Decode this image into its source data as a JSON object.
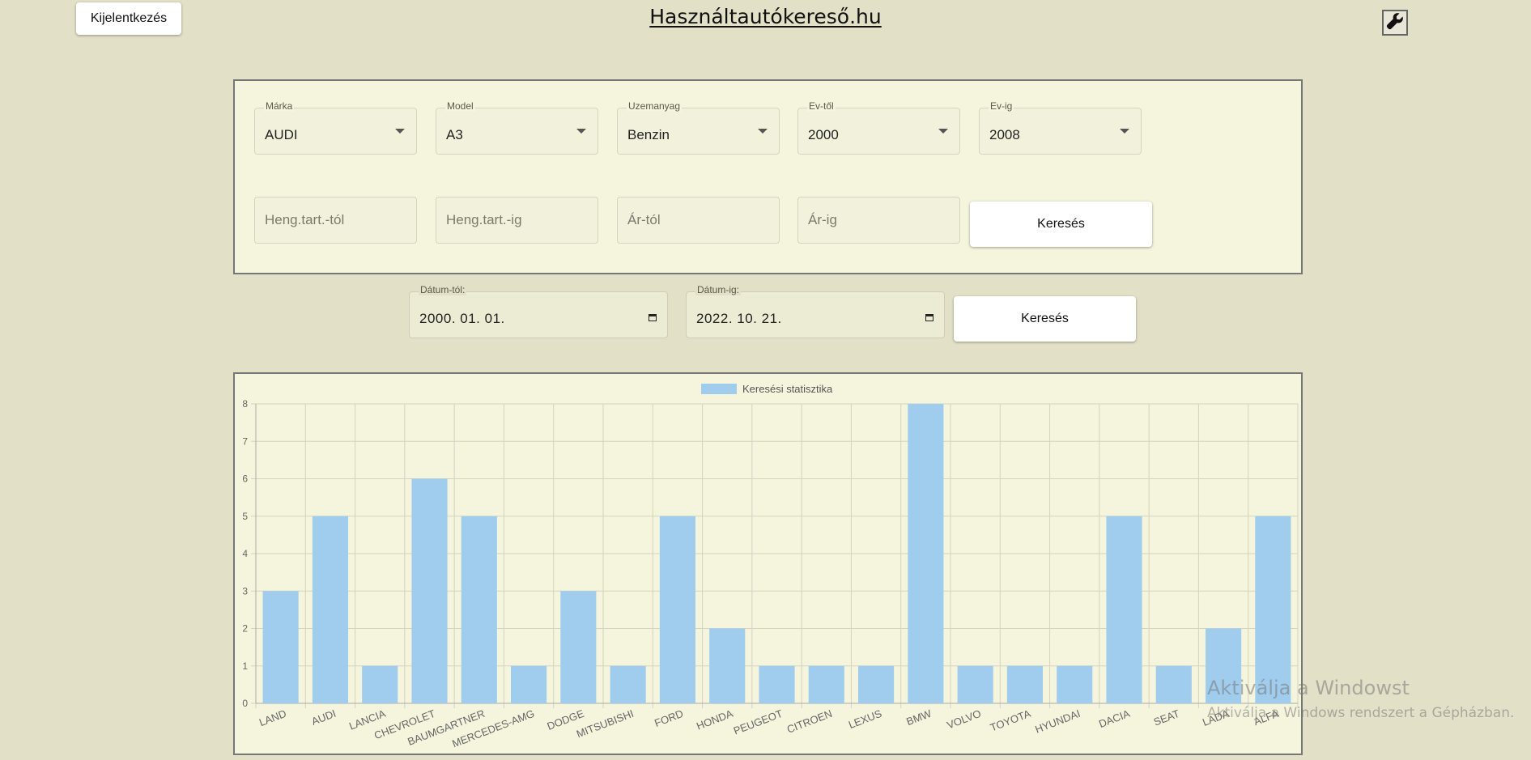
{
  "header": {
    "logout_label": "Kijelentkezés",
    "title": "Használtautókereső.hu",
    "settings_icon": "wrench-icon"
  },
  "filters": {
    "marka": {
      "label": "Márka",
      "value": "AUDI"
    },
    "model": {
      "label": "Model",
      "value": "A3"
    },
    "uzemanyag": {
      "label": "Uzemanyag",
      "value": "Benzin"
    },
    "ev_tol": {
      "label": "Ev-től",
      "value": "2000"
    },
    "ev_ig": {
      "label": "Ev-ig",
      "value": "2008"
    },
    "heng_tol_placeholder": "Heng.tart.-tól",
    "heng_ig_placeholder": "Heng.tart.-ig",
    "ar_tol_placeholder": "Ár-tól",
    "ar_ig_placeholder": "Ár-ig",
    "search_label": "Keresés"
  },
  "date_filter": {
    "from_label": "Dátum-tól:",
    "from_value": "2000. 01. 01.",
    "to_label": "Dátum-ig:",
    "to_value": "2022. 10. 21.",
    "search_label": "Keresés"
  },
  "chart_data": {
    "type": "bar",
    "categories": [
      "LAND",
      "AUDI",
      "LANCIA",
      "CHEVROLET",
      "BAUMGARTNER",
      "MERCEDES-AMG",
      "DODGE",
      "MITSUBISHI",
      "FORD",
      "HONDA",
      "PEUGEOT",
      "CITROEN",
      "LEXUS",
      "BMW",
      "VOLVO",
      "TOYOTA",
      "HYUNDAI",
      "DACIA",
      "SEAT",
      "LADA",
      "ALFA"
    ],
    "series": [
      {
        "name": "Keresési statisztika",
        "values": [
          3,
          5,
          1,
          6,
          5,
          1,
          3,
          1,
          5,
          2,
          1,
          1,
          1,
          8,
          1,
          1,
          1,
          5,
          1,
          2,
          5
        ]
      }
    ],
    "ylim": [
      0,
      8
    ],
    "yticks": [
      "0",
      "1",
      "2",
      "3",
      "4",
      "5",
      "6",
      "7",
      "8"
    ],
    "grid": true,
    "legend": "top",
    "bar_color": "#a0cdee"
  },
  "watermark": {
    "line1": "Aktiválja a Windowst",
    "line2": "Aktiválja a Windows rendszert a Gépházban."
  }
}
